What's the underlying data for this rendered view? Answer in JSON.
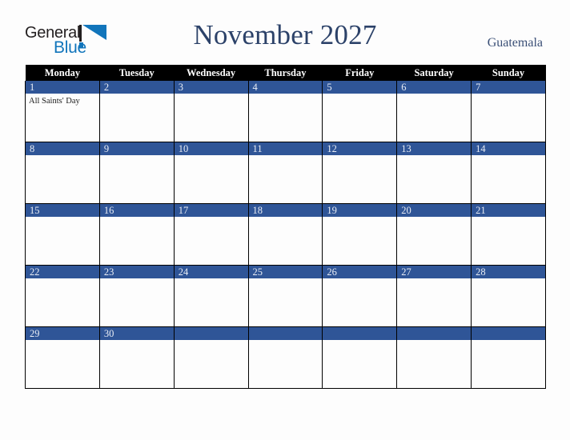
{
  "brand": {
    "text_general": "General",
    "text_blue": "Blue",
    "color_dark": "#231f20",
    "color_blue": "#1175bb"
  },
  "header": {
    "month_title": "November 2027",
    "country": "Guatemala",
    "title_color": "#2c4269"
  },
  "calendar": {
    "accent_color": "#2f5597",
    "header_bg": "#000000",
    "weekday_headers": [
      "Monday",
      "Tuesday",
      "Wednesday",
      "Thursday",
      "Friday",
      "Saturday",
      "Sunday"
    ],
    "weeks": [
      [
        {
          "day": "1",
          "events": [
            "All Saints' Day"
          ]
        },
        {
          "day": "2",
          "events": []
        },
        {
          "day": "3",
          "events": []
        },
        {
          "day": "4",
          "events": []
        },
        {
          "day": "5",
          "events": []
        },
        {
          "day": "6",
          "events": []
        },
        {
          "day": "7",
          "events": []
        }
      ],
      [
        {
          "day": "8",
          "events": []
        },
        {
          "day": "9",
          "events": []
        },
        {
          "day": "10",
          "events": []
        },
        {
          "day": "11",
          "events": []
        },
        {
          "day": "12",
          "events": []
        },
        {
          "day": "13",
          "events": []
        },
        {
          "day": "14",
          "events": []
        }
      ],
      [
        {
          "day": "15",
          "events": []
        },
        {
          "day": "16",
          "events": []
        },
        {
          "day": "17",
          "events": []
        },
        {
          "day": "18",
          "events": []
        },
        {
          "day": "19",
          "events": []
        },
        {
          "day": "20",
          "events": []
        },
        {
          "day": "21",
          "events": []
        }
      ],
      [
        {
          "day": "22",
          "events": []
        },
        {
          "day": "23",
          "events": []
        },
        {
          "day": "24",
          "events": []
        },
        {
          "day": "25",
          "events": []
        },
        {
          "day": "26",
          "events": []
        },
        {
          "day": "27",
          "events": []
        },
        {
          "day": "28",
          "events": []
        }
      ],
      [
        {
          "day": "29",
          "events": []
        },
        {
          "day": "30",
          "events": []
        },
        {
          "day": "",
          "events": []
        },
        {
          "day": "",
          "events": []
        },
        {
          "day": "",
          "events": []
        },
        {
          "day": "",
          "events": []
        },
        {
          "day": "",
          "events": []
        }
      ]
    ]
  }
}
